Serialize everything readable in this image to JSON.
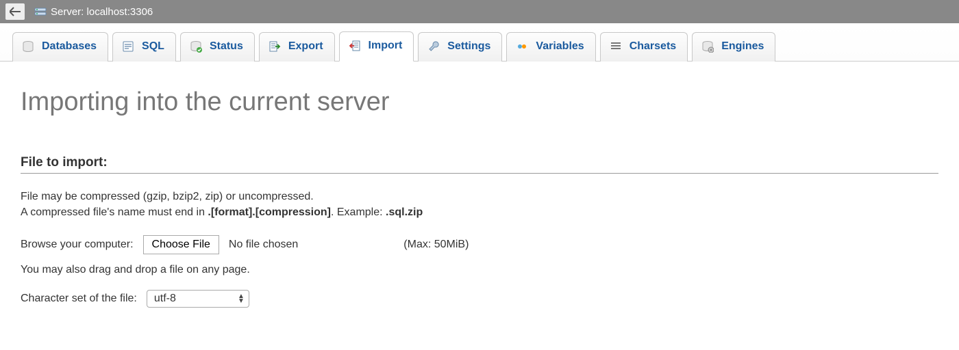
{
  "breadcrumb": {
    "server_label": "Server: localhost:3306"
  },
  "tabs": [
    {
      "key": "databases",
      "label": "Databases"
    },
    {
      "key": "sql",
      "label": "SQL"
    },
    {
      "key": "status",
      "label": "Status"
    },
    {
      "key": "export",
      "label": "Export"
    },
    {
      "key": "import",
      "label": "Import",
      "active": true
    },
    {
      "key": "settings",
      "label": "Settings"
    },
    {
      "key": "variables",
      "label": "Variables"
    },
    {
      "key": "charsets",
      "label": "Charsets"
    },
    {
      "key": "engines",
      "label": "Engines"
    }
  ],
  "page": {
    "title": "Importing into the current server"
  },
  "import": {
    "section_title": "File to import:",
    "help_line1": "File may be compressed (gzip, bzip2, zip) or uncompressed.",
    "help_line2_prefix": "A compressed file's name must end in ",
    "help_line2_bold1": ".[format].[compression]",
    "help_line2_mid": ". Example: ",
    "help_line2_bold2": ".sql.zip",
    "browse_label": "Browse your computer:",
    "choose_file_btn": "Choose File",
    "no_file_text": "No file chosen",
    "max_size": "(Max: 50MiB)",
    "drag_drop_note": "You may also drag and drop a file on any page.",
    "charset_label": "Character set of the file:",
    "charset_value": "utf-8"
  }
}
